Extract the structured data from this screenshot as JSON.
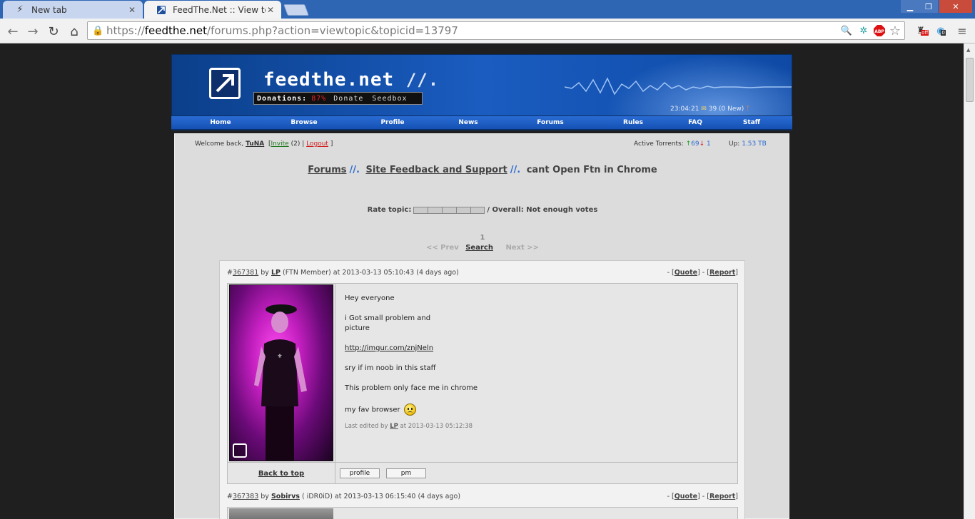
{
  "browser": {
    "tabs": [
      {
        "title": "New tab",
        "active": false
      },
      {
        "title": "FeedThe.Net :: View topic",
        "active": true
      }
    ],
    "url_scheme": "https://",
    "url_host": "feedthe.net",
    "url_path": "/forums.php?action=viewtopic&topicid=13797",
    "ext_badge_off": "off",
    "ext_badge_count": "0"
  },
  "banner": {
    "site_title": "feedthe.net",
    "title_suffix": "//.",
    "donations_label": "Donations:",
    "donations_pct": "87%",
    "donate_link": "Donate",
    "seedbox_link": "Seedbox",
    "time": "23:04:21",
    "messages": "39 (0 New)"
  },
  "nav": [
    "Home",
    "Browse",
    "Profile",
    "News",
    "Forums",
    "Rules",
    "FAQ",
    "Staff"
  ],
  "userbar": {
    "welcome": "Welcome back,",
    "username": "TuNA",
    "invite": "Invite",
    "invite_count": "(2) |",
    "logout": "Logout",
    "active_torrents_label": "Active Torrents:",
    "seeding": "69",
    "leeching": "1",
    "up_label": "Up:",
    "up_value": "1.53 TB"
  },
  "breadcrumb": {
    "forums": "Forums",
    "section": "Site Feedback and Support",
    "topic": "cant Open Ftn in Chrome",
    "sep": "//."
  },
  "rating": {
    "label": "Rate topic:",
    "overall": "/ Overall: Not enough votes"
  },
  "pager": {
    "page": "1",
    "prev": "<< Prev",
    "search": "Search",
    "next": "Next >>"
  },
  "posts": [
    {
      "hash": "#",
      "id": "367381",
      "by": "by",
      "author": "LP",
      "rank": "(FTN Member) at 2013-03-13 05:10:43 (4 days ago)",
      "quote": "Quote",
      "report": "Report",
      "lines": [
        "Hey everyone",
        "i Got small problem and",
        "picture",
        "http://imgur.com/znjNeln",
        "sry if im noob in this staff",
        "This problem only face me in chrome",
        "my fav browser"
      ],
      "edited_prefix": "Last edited by",
      "edited_by": "LP",
      "edited_at": "at 2013-03-13 05:12:38",
      "back_to_top": "Back to top",
      "profile_btn": "profile",
      "pm_btn": "pm"
    },
    {
      "hash": "#",
      "id": "367383",
      "by": "by",
      "author": "Sobirvs",
      "rank": "( iDR0iD) at 2013-03-13 06:15:40 (4 days ago)",
      "quote": "Quote",
      "report": "Report"
    }
  ]
}
